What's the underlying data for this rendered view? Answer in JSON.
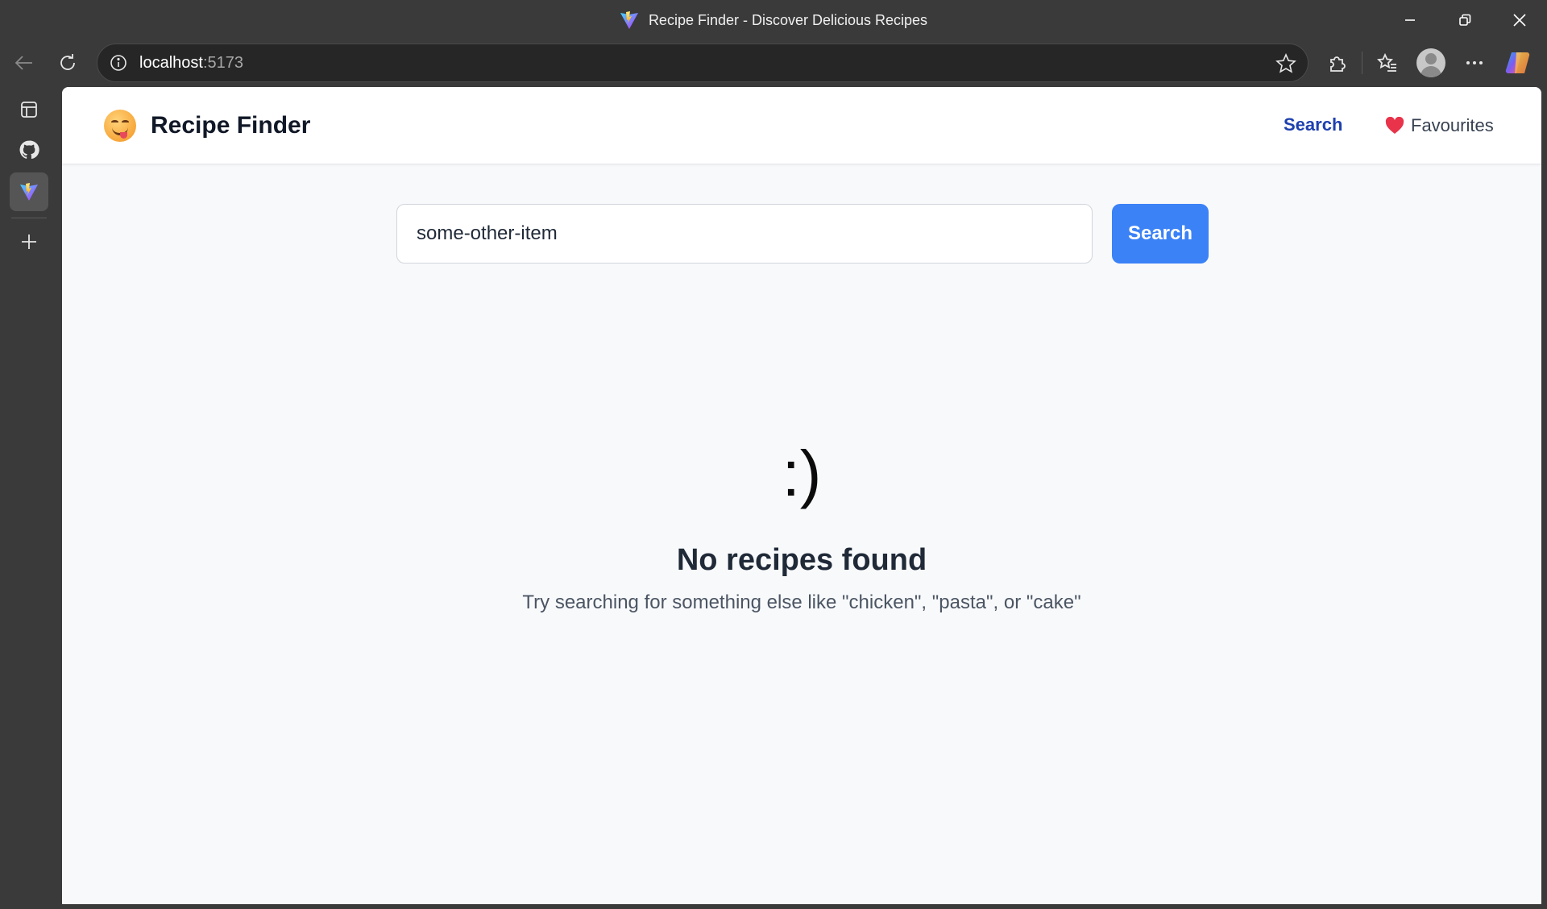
{
  "window": {
    "title": "Recipe Finder - Discover Delicious Recipes"
  },
  "browser": {
    "url_host": "localhost",
    "url_port": ":5173"
  },
  "app": {
    "brand_name": "Recipe Finder",
    "brand_icon": "yum-face-emoji",
    "nav": {
      "search_label": "Search",
      "favourites_label": "Favourites",
      "favourites_icon": "heart-icon"
    },
    "search": {
      "input_value": "some-other-item",
      "button_label": "Search"
    },
    "empty_state": {
      "face": ":)",
      "title": "No recipes found",
      "subtitle": "Try searching for something else like \"chicken\", \"pasta\", or \"cake\""
    }
  },
  "colors": {
    "accent": "#3b82f6",
    "nav_active": "#1e40af",
    "heart": "#e8334a"
  }
}
